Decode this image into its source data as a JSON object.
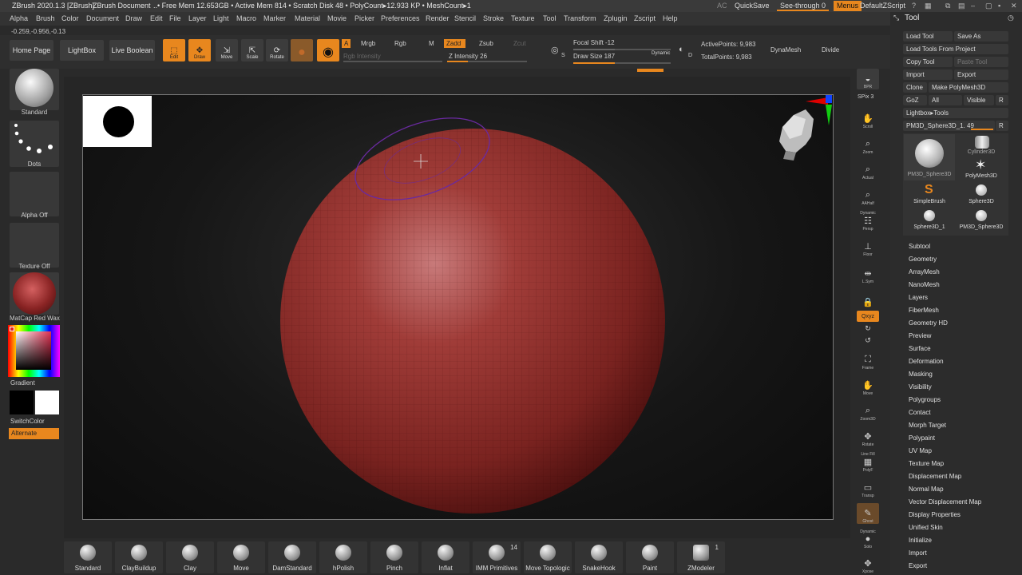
{
  "titlebar": {
    "app": "ZBrush 2020.1.3 [ZBrush]",
    "document": "ZBrush Document",
    "stats": "..• Free Mem 12.653GB • Active Mem 814 • Scratch Disk 48 • PolyCount▸12.933 KP • MeshCount▸1",
    "ac": "AC",
    "quicksave": "QuickSave",
    "seethrough": "See-through  0",
    "menus": "Menus",
    "zscript": "DefaultZScript"
  },
  "menubar": [
    "Alpha",
    "Brush",
    "Color",
    "Document",
    "Draw",
    "Edit",
    "File",
    "Layer",
    "Light",
    "Macro",
    "Marker",
    "Material",
    "Movie",
    "Picker",
    "Preferences",
    "Render",
    "Stencil",
    "Stroke",
    "Texture",
    "Tool",
    "Transform",
    "Zplugin",
    "Zscript",
    "Help"
  ],
  "coord": "-0.259,-0.956,-0.13",
  "shelf": {
    "home_page": "Home Page",
    "lightbox": "LightBox",
    "live_boolean": "Live Boolean",
    "edit": "Edit",
    "draw": "Draw",
    "move": "Move",
    "scale": "Scale",
    "rotate": "Rotate",
    "a": "A",
    "mrgb": "Mrgb",
    "rgb": "Rgb",
    "m": "M",
    "zadd": "Zadd",
    "zsub": "Zsub",
    "zcut": "Zcut",
    "rgb_intensity": "Rgb Intensity",
    "z_intensity": "Z Intensity 26",
    "z_intensity_value": 26,
    "focal_shift": "Focal Shift -12",
    "draw_size": "Draw Size 187",
    "dynamic": "Dynamic",
    "active_points": "ActivePoints: 9,983",
    "total_points": "TotalPoints: 9,983",
    "dynamesh": "DynaMesh",
    "divide": "Divide",
    "s_key": "S",
    "d_key": "D"
  },
  "leftpanel": {
    "brush": "Standard",
    "stroke": "Dots",
    "alpha": "Alpha Off",
    "texture": "Texture Off",
    "material": "MatCap Red Wax",
    "gradient": "Gradient",
    "switchcolor": "SwitchColor",
    "alternate": "Alternate"
  },
  "rtools": [
    "BPR",
    "SPix 3",
    "Scroll",
    "Zoom",
    "Actual",
    "AAHalf",
    "Dynamic",
    "Persp",
    "Floor",
    "L.Sym",
    "",
    "Qxyz",
    "",
    "",
    "Frame",
    "Move",
    "Zoom3D",
    "Rotate",
    "Line Fill",
    "PolyF",
    "Transp",
    "Ghost",
    "Dynamic",
    "Solo",
    "Xpose"
  ],
  "toolpanel": {
    "title": "Tool",
    "load_tool": "Load Tool",
    "save_as": "Save As",
    "load_from_project": "Load Tools From Project",
    "copy_tool": "Copy Tool",
    "paste_tool": "Paste Tool",
    "import": "Import",
    "export": "Export",
    "clone": "Clone",
    "make_polymesh": "Make PolyMesh3D",
    "goz": "GoZ",
    "all": "All",
    "visible": "Visible",
    "r": "R",
    "lightbox_tools": "Lightbox▸Tools",
    "current_tool": "PM3D_Sphere3D_1. 49",
    "thumbs": [
      "PM3D_Sphere3D",
      "Cylinder3D",
      "PolyMesh3D",
      "SimpleBrush",
      "Sphere3D",
      "Sphere3D_1",
      "PM3D_Sphere3D"
    ],
    "items": [
      "Subtool",
      "Geometry",
      "ArrayMesh",
      "NanoMesh",
      "Layers",
      "FiberMesh",
      "Geometry HD",
      "Preview",
      "Surface",
      "Deformation",
      "Masking",
      "Visibility",
      "Polygroups",
      "Contact",
      "Morph Target",
      "Polypaint",
      "UV Map",
      "Texture Map",
      "Displacement Map",
      "Normal Map",
      "Vector Displacement Map",
      "Display Properties",
      "Unified Skin",
      "Initialize",
      "Import",
      "Export"
    ]
  },
  "bottomshelf": {
    "brushes": [
      "Standard",
      "ClayBuildup",
      "Clay",
      "Move",
      "DamStandard",
      "hPolish",
      "Pinch",
      "Inflat",
      "IMM Primitives",
      "Move Topologic",
      "SnakeHook",
      "Paint",
      "ZModeler"
    ],
    "imm_count": "14",
    "zmodeler_count": "1"
  },
  "colors": {
    "accent": "#e8871e",
    "sphere": "#8a2a26"
  }
}
